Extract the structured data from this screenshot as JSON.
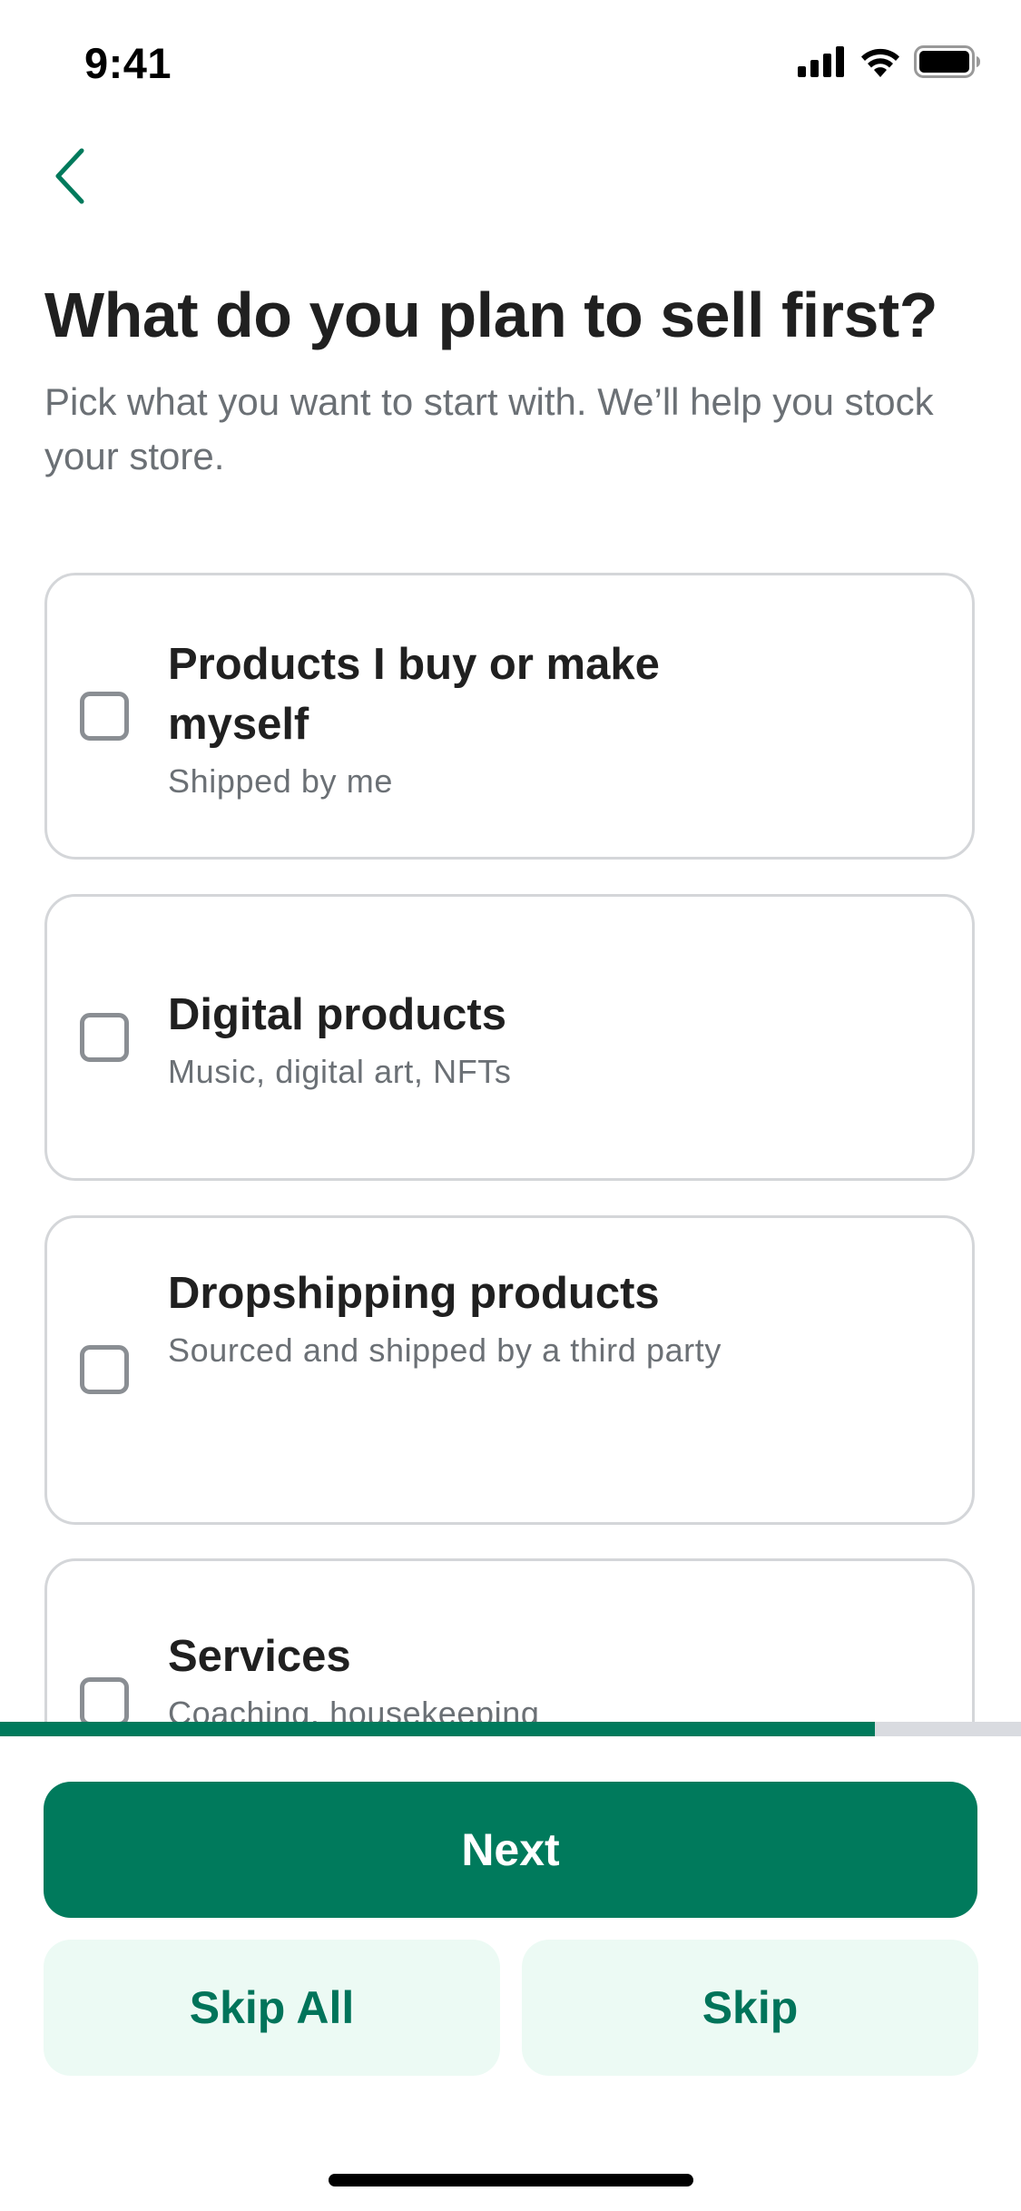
{
  "status_bar": {
    "time": "9:41",
    "icons": [
      "cellular-signal-icon",
      "wifi-icon",
      "battery-icon"
    ]
  },
  "nav": {
    "back_icon": "chevron-left-icon",
    "accent_color": "#007a5c"
  },
  "header": {
    "title": "What do you plan to sell first?",
    "subtitle": "Pick what you want to start with. We’ll help you stock your store."
  },
  "options": [
    {
      "title": "Products I buy or make myself",
      "description": "Shipped by me",
      "checked": false
    },
    {
      "title": "Digital products",
      "description": "Music, digital art, NFTs",
      "checked": false
    },
    {
      "title": "Dropshipping products",
      "description": "Sourced and shipped by a third party",
      "checked": false
    },
    {
      "title": "Services",
      "description": "Coaching, housekeeping",
      "checked": false
    }
  ],
  "progress": {
    "fraction": 0.857,
    "fill_color": "#007a5c",
    "track_color": "#d9dbe0"
  },
  "actions": {
    "next_label": "Next",
    "skip_all_label": "Skip All",
    "skip_label": "Skip"
  }
}
